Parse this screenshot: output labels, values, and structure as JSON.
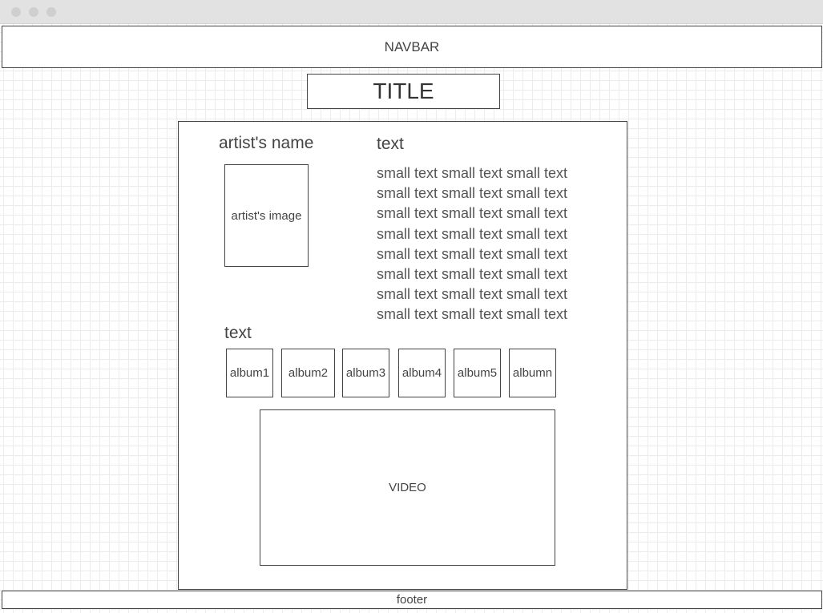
{
  "navbar": {
    "label": "NAVBAR"
  },
  "title": {
    "label": "TITLE"
  },
  "artist": {
    "name": "artist's name",
    "image_label": "artist's image"
  },
  "bio": {
    "heading": "text",
    "lines": [
      "small text small text small text",
      "small text small text small text",
      "small text small text small text",
      "small text small text small text",
      "small text small text small text",
      "small text small text small text",
      "small text small text small text",
      "small text small text small text"
    ]
  },
  "albums": {
    "heading": "text",
    "items": [
      "album1",
      "album2",
      "album3",
      "album4",
      "album5",
      "albumn"
    ]
  },
  "video": {
    "label": "VIDEO"
  },
  "footer": {
    "label": "footer"
  }
}
